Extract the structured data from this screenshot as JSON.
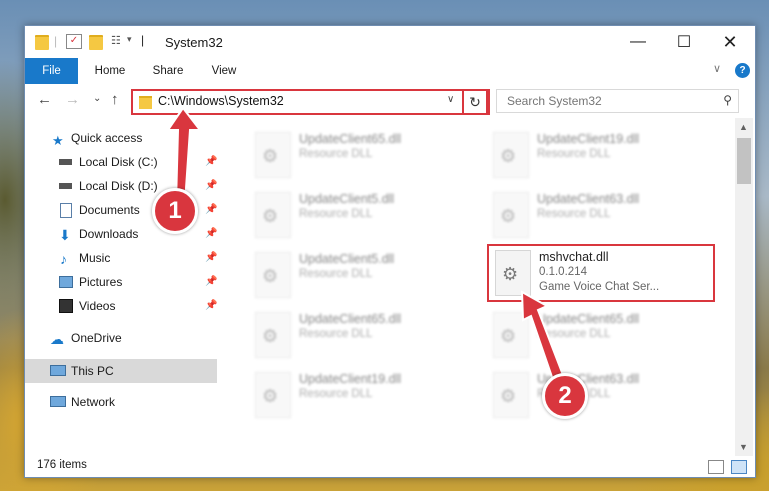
{
  "window": {
    "title": "System32"
  },
  "ribbon": {
    "tabs": [
      "File",
      "Home",
      "Share",
      "View"
    ],
    "help": "?"
  },
  "nav": {
    "address": "C:\\Windows\\System32",
    "search_placeholder": "Search System32"
  },
  "sidebar": {
    "items": [
      {
        "label": "Quick access",
        "icon": "star-icon"
      },
      {
        "label": "Local Disk (C:)",
        "icon": "drive-icon",
        "pinned": true
      },
      {
        "label": "Local Disk (D:)",
        "icon": "drive-icon",
        "pinned": true
      },
      {
        "label": "Documents",
        "icon": "documents-icon",
        "pinned": true
      },
      {
        "label": "Downloads",
        "icon": "download-icon",
        "pinned": true
      },
      {
        "label": "Music",
        "icon": "music-icon",
        "pinned": true
      },
      {
        "label": "Pictures",
        "icon": "pictures-icon",
        "pinned": true
      },
      {
        "label": "Videos",
        "icon": "videos-icon",
        "pinned": true
      },
      {
        "label": "OneDrive",
        "icon": "cloud-icon"
      },
      {
        "label": "This PC",
        "icon": "computer-icon"
      },
      {
        "label": "Network",
        "icon": "network-icon"
      }
    ]
  },
  "files": {
    "items": [
      {
        "name": "UpdateClient65.dll",
        "type": "Resource DLL"
      },
      {
        "name": "UpdateClient19.dll",
        "type": "Resource DLL"
      },
      {
        "name": "UpdateClient5.dll",
        "type": "Resource DLL"
      },
      {
        "name": "UpdateClient63.dll",
        "type": "Resource DLL"
      },
      {
        "name": "UpdateClient5.dll",
        "type": "Resource DLL"
      },
      {
        "name": "mshvchat.dll",
        "version": "0.1.0.214",
        "type": "Game Voice Chat Ser..."
      },
      {
        "name": "UpdateClient65.dll",
        "type": "Resource DLL"
      },
      {
        "name": "UpdateClient65.dll",
        "type": "Resource DLL"
      },
      {
        "name": "UpdateClient19.dll",
        "type": "Resource DLL"
      },
      {
        "name": "UpdateClient63.dll",
        "type": "Resource DLL"
      }
    ]
  },
  "status": {
    "count": "176 items"
  },
  "annotations": {
    "step1": "1",
    "step2": "2"
  },
  "colors": {
    "accent": "#1979ca",
    "highlight": "#d9363e",
    "selection": "#cce8ff"
  }
}
